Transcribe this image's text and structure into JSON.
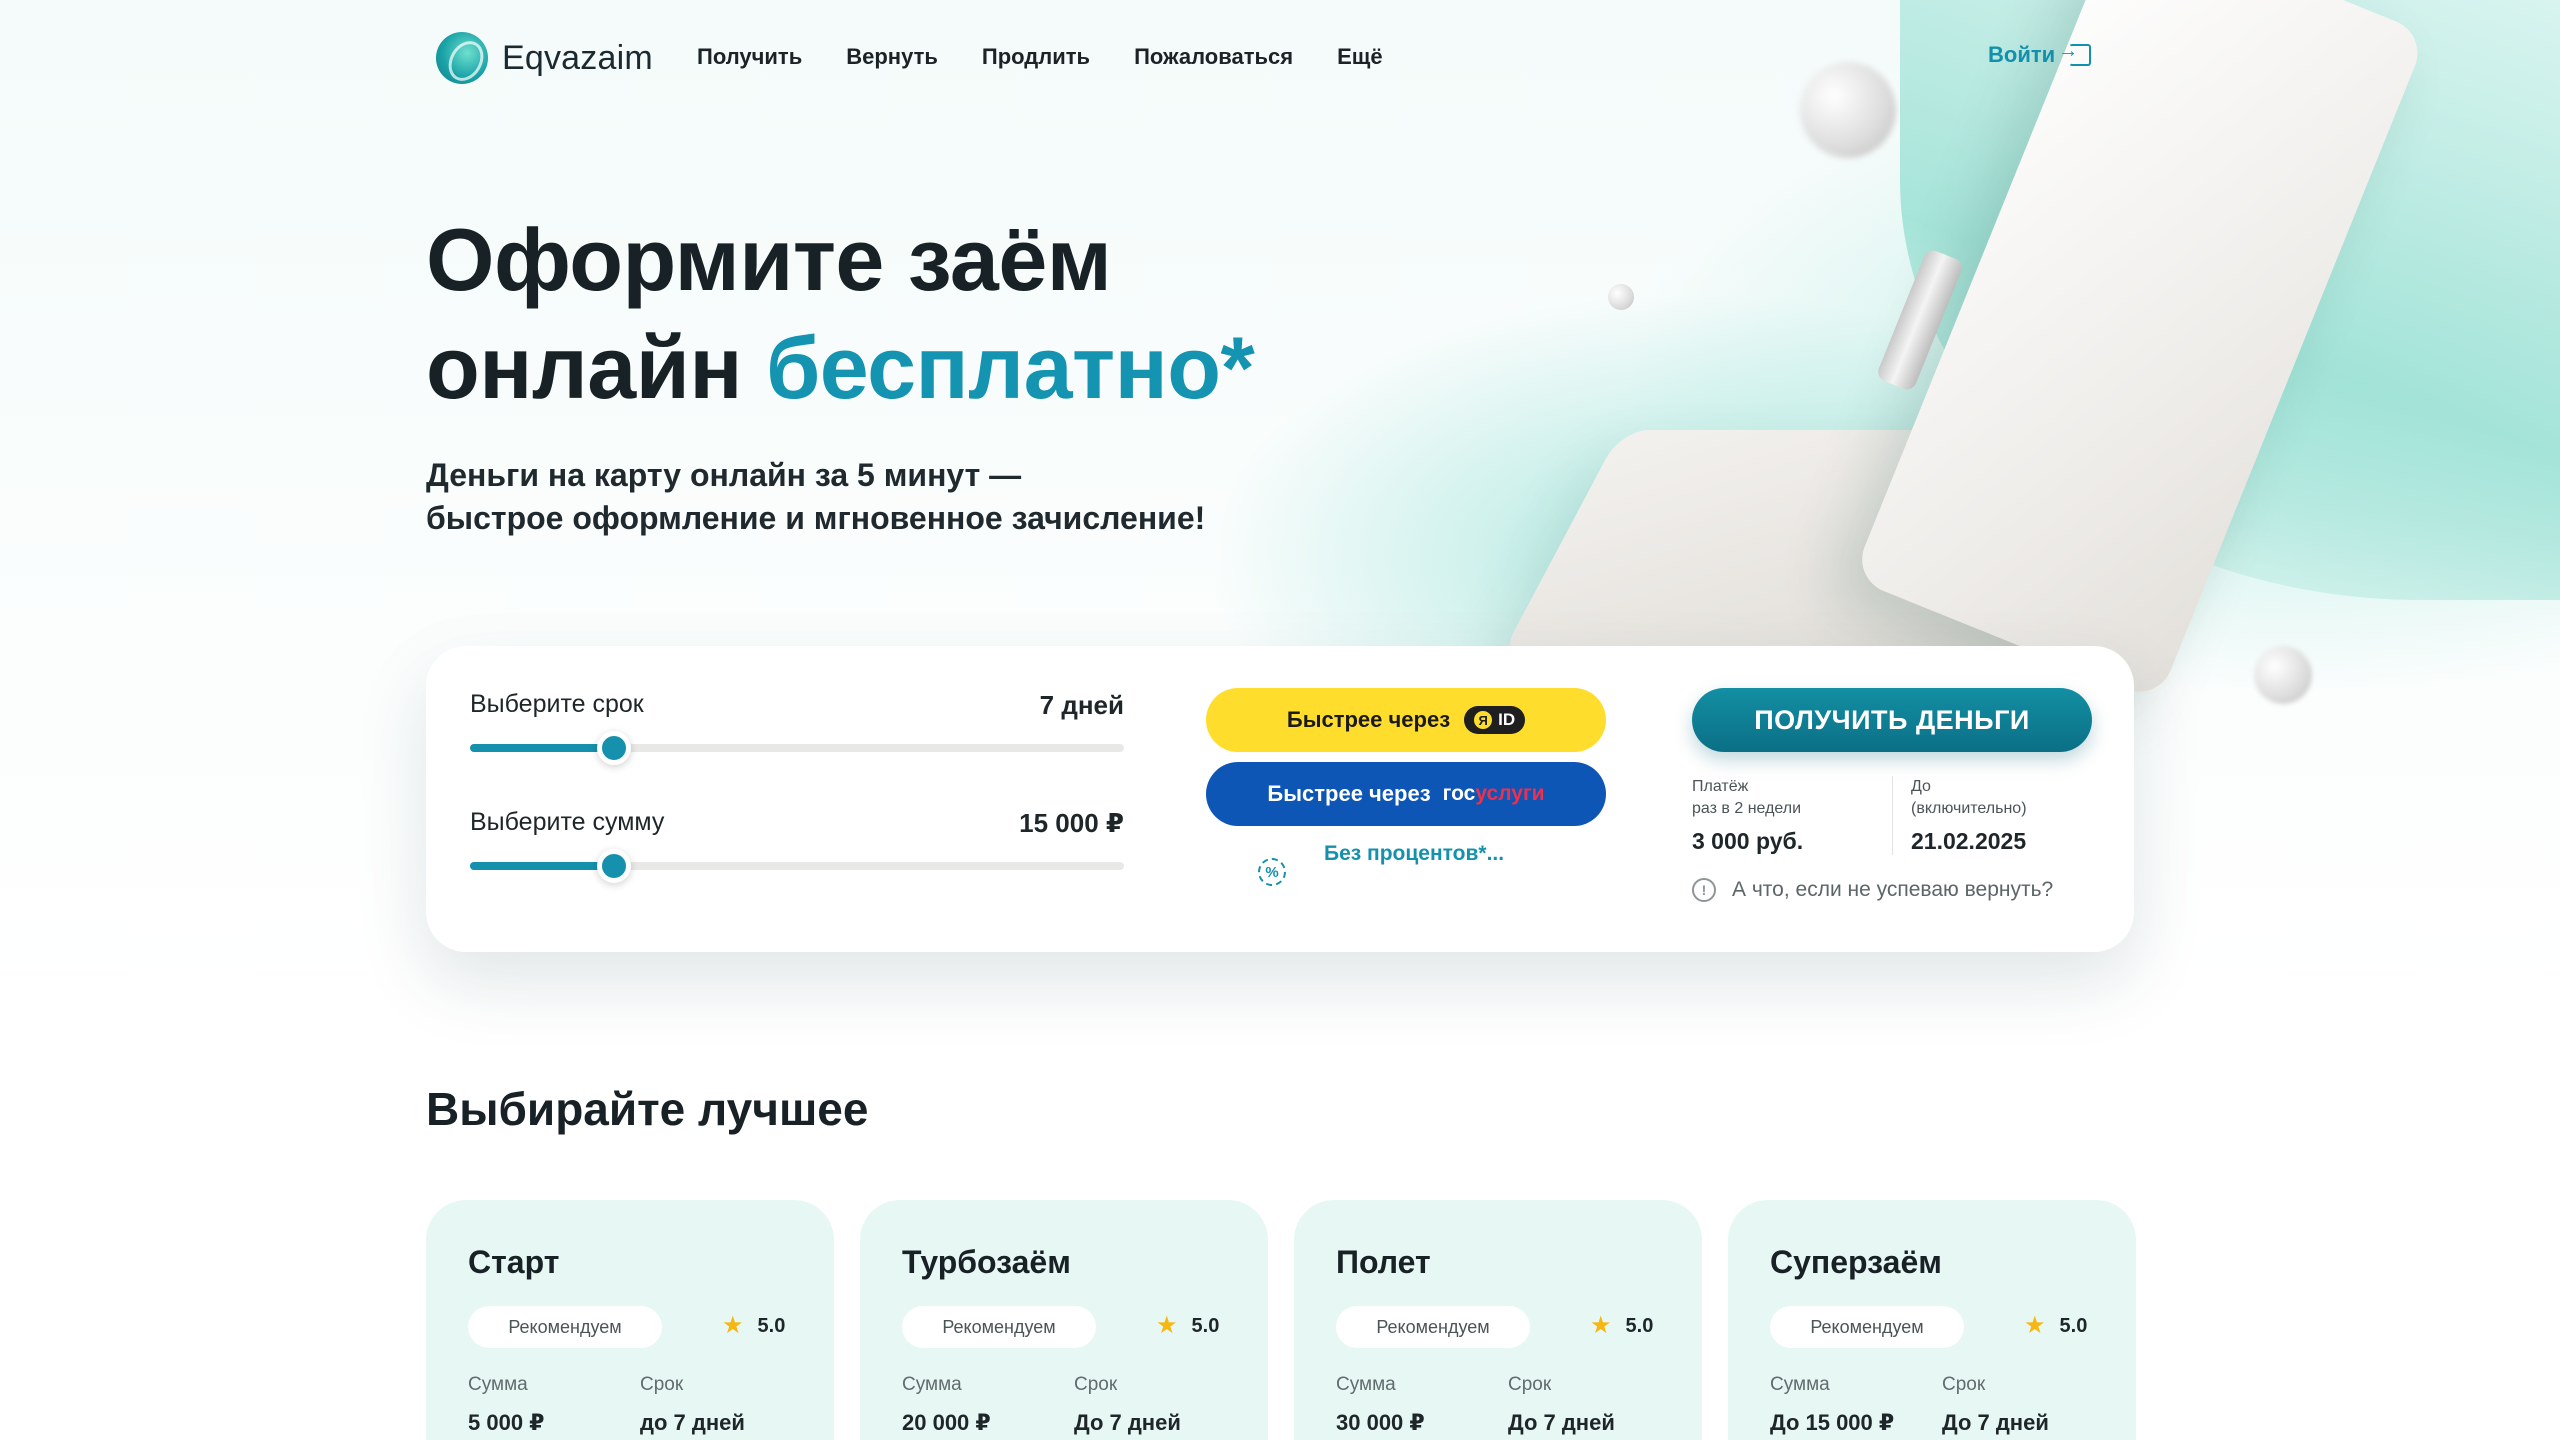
{
  "header": {
    "logo_text": "Eqvazaim",
    "nav": [
      "Получить",
      "Вернуть",
      "Продлить",
      "Пожаловаться",
      "Ещё"
    ],
    "login_label": "Войти"
  },
  "hero": {
    "title_line1": "Оформите заём",
    "title_line2_plain": "онлайн ",
    "title_line2_accent": "бесплатно*",
    "subtitle_line1": "Деньги на карту онлайн за 5 минут —",
    "subtitle_line2": "быстрое оформление и мгновенное зачисление!"
  },
  "calculator": {
    "term": {
      "label": "Выберите срок",
      "value": "7 дней",
      "fill": 0.22
    },
    "amount": {
      "label": "Выберите сумму",
      "value": "15 000 ₽",
      "fill": 0.22
    },
    "yandex_button": {
      "label": "Быстрее через",
      "badge": "ID"
    },
    "gos_button": {
      "label": "Быстрее через",
      "logo_part1": "гос",
      "logo_part2": "услуги"
    },
    "no_percent_link": "Без процентов*...",
    "get_money_button": "ПОЛУЧИТЬ ДЕНЬГИ",
    "payment": {
      "label_line1": "Платёж",
      "label_line2": "раз в 2 недели",
      "value": "3 000 руб."
    },
    "due": {
      "label_line1": "До",
      "label_line2": "(включительно)",
      "value": "21.02.2025"
    },
    "help_text": "А что, если не успеваю вернуть?"
  },
  "offers_section": {
    "title": "Выбирайте лучшее",
    "items": [
      {
        "title": "Старт",
        "badge": "Рекомендуем",
        "rating": "5.0",
        "amount_label": "Сумма",
        "amount": "5 000 ₽",
        "term_label": "Срок",
        "term": "до 7 дней"
      },
      {
        "title": "Турбозаём",
        "badge": "Рекомендуем",
        "rating": "5.0",
        "amount_label": "Сумма",
        "amount": "20 000 ₽",
        "term_label": "Срок",
        "term": "До 7 дней"
      },
      {
        "title": "Полет",
        "badge": "Рекомендуем",
        "rating": "5.0",
        "amount_label": "Сумма",
        "amount": "30 000 ₽",
        "term_label": "Срок",
        "term": "До 7 дней"
      },
      {
        "title": "Суперзаём",
        "badge": "Рекомендуем",
        "rating": "5.0",
        "amount_label": "Сумма",
        "amount": "До 15 000 ₽",
        "term_label": "Срок",
        "term": "До 7 дней"
      }
    ]
  },
  "colors": {
    "accent": "#1494b1",
    "yandex_yellow": "#ffdd2d",
    "gosuslugi_blue": "#0d56b5",
    "offer_card_bg": "#e6f7f4"
  },
  "icons": {
    "logo": "eqvazaim-logo-icon",
    "login": "login-arrow-icon",
    "percent": "percent-badge-icon",
    "help": "info-circle-icon",
    "star": "star-icon"
  }
}
